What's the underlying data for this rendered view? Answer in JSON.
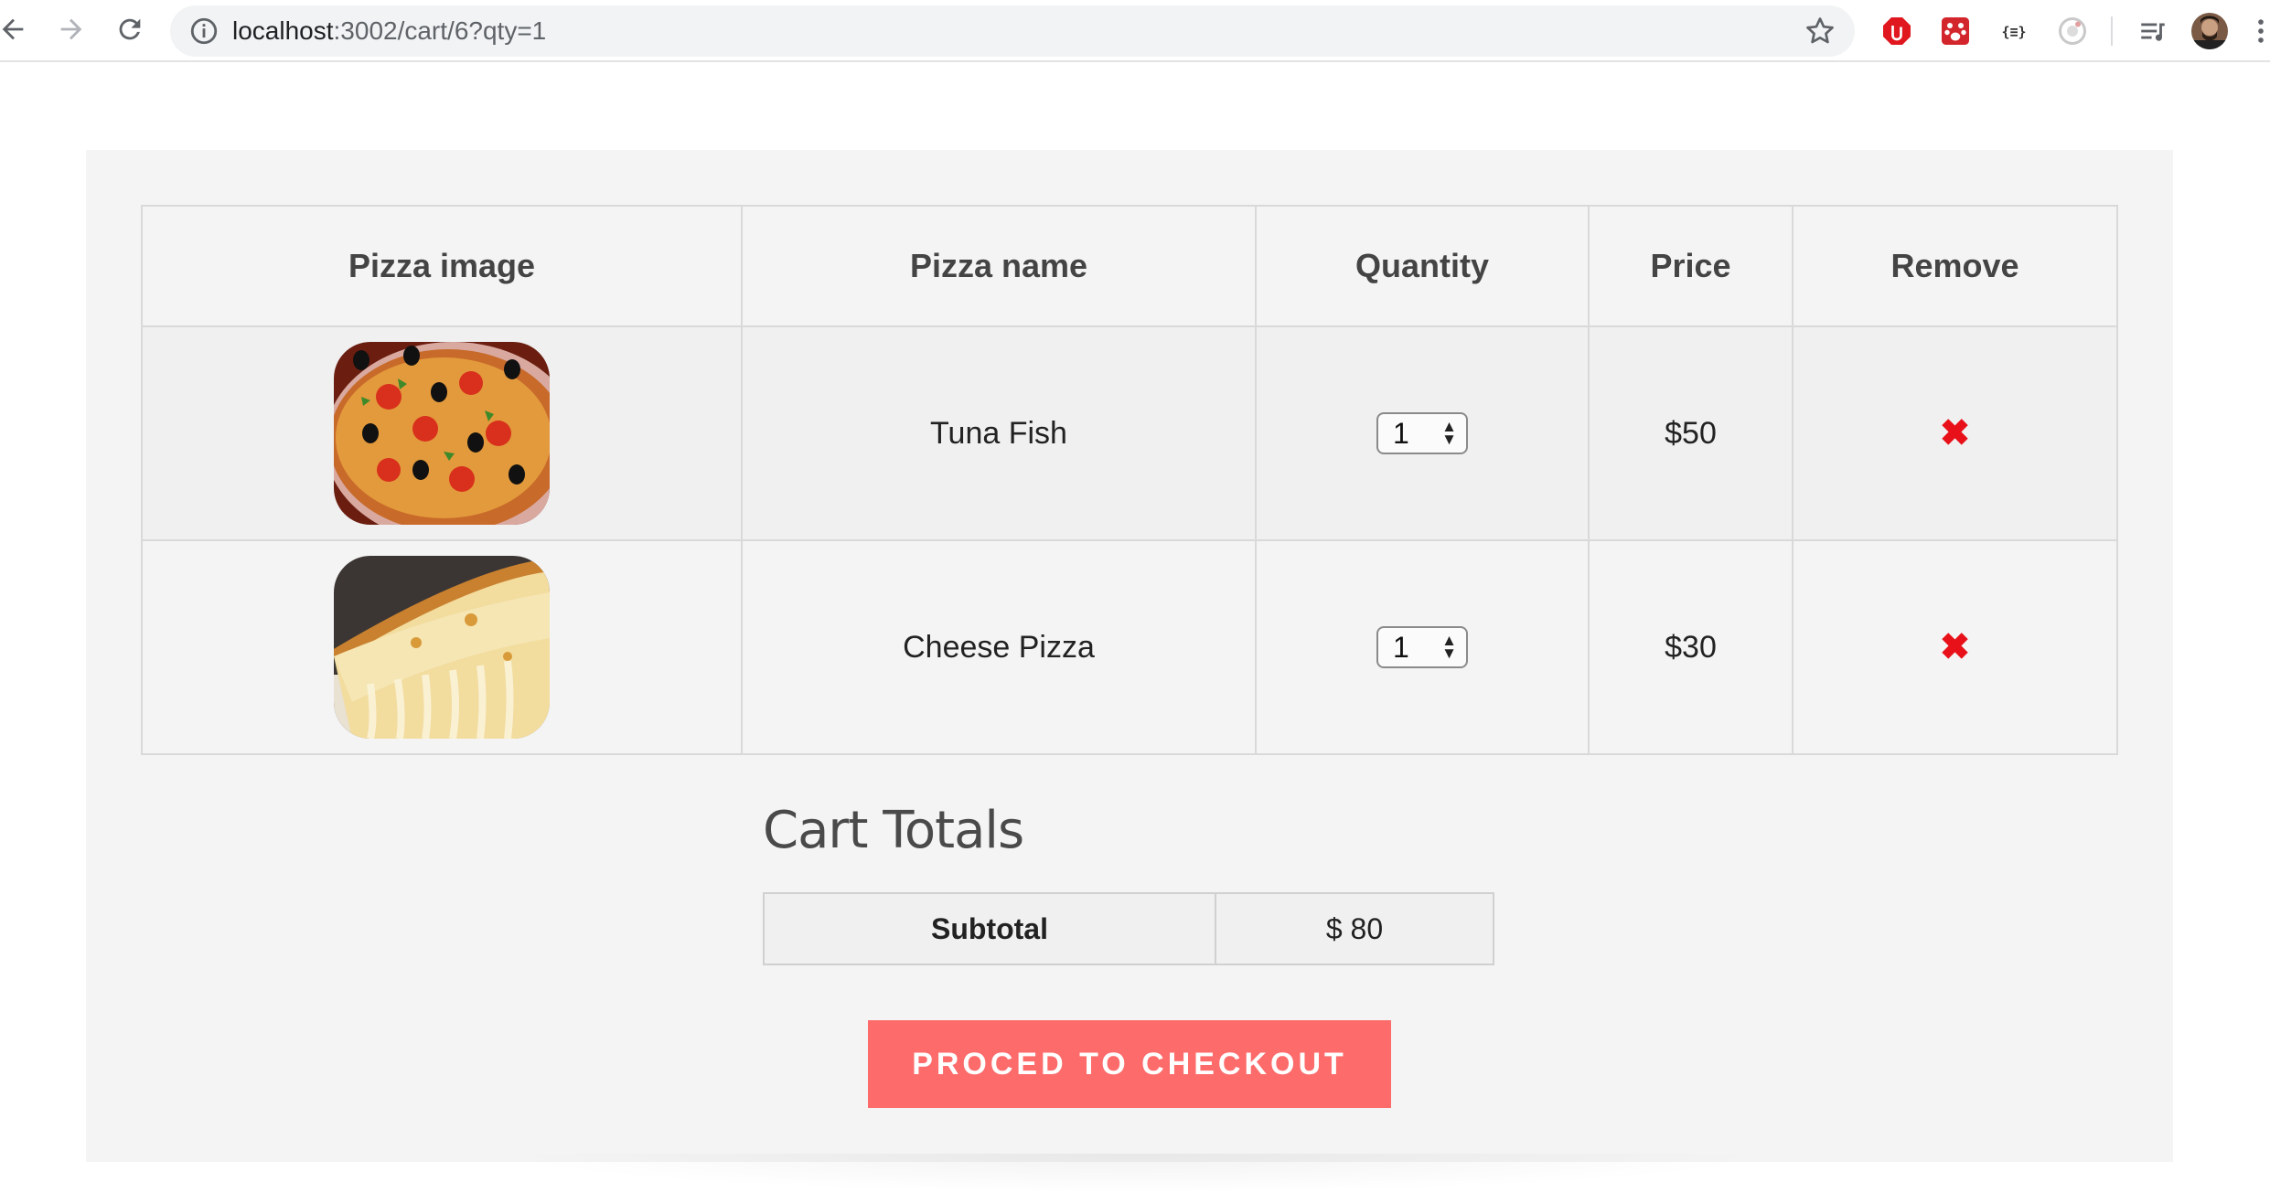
{
  "browser": {
    "url_host": "localhost",
    "url_path": ":3002/cart/6?qty=1",
    "extensions": [
      "stop-extension-icon",
      "paw-extension-icon",
      "json-extension-icon",
      "circle-extension-icon",
      "media-queue-icon",
      "profile-avatar"
    ]
  },
  "cart": {
    "headers": {
      "image": "Pizza image",
      "name": "Pizza name",
      "quantity": "Quantity",
      "price": "Price",
      "remove": "Remove"
    },
    "items": [
      {
        "name": "Tuna Fish",
        "quantity": "1",
        "price": "$50",
        "remove": "✖",
        "image": "pizza-topped-image"
      },
      {
        "name": "Cheese Pizza",
        "quantity": "1",
        "price": "$30",
        "remove": "✖",
        "image": "cheese-pizza-slice-image"
      }
    ]
  },
  "totals": {
    "title": "Cart Totals",
    "subtotal_label": "Subtotal",
    "subtotal_value": "$ 80"
  },
  "checkout": {
    "label": "PROCED TO CHECKOUT"
  },
  "colors": {
    "accent": "#fd6b6b",
    "remove": "#e8111a",
    "panel": "#f4f4f4"
  }
}
